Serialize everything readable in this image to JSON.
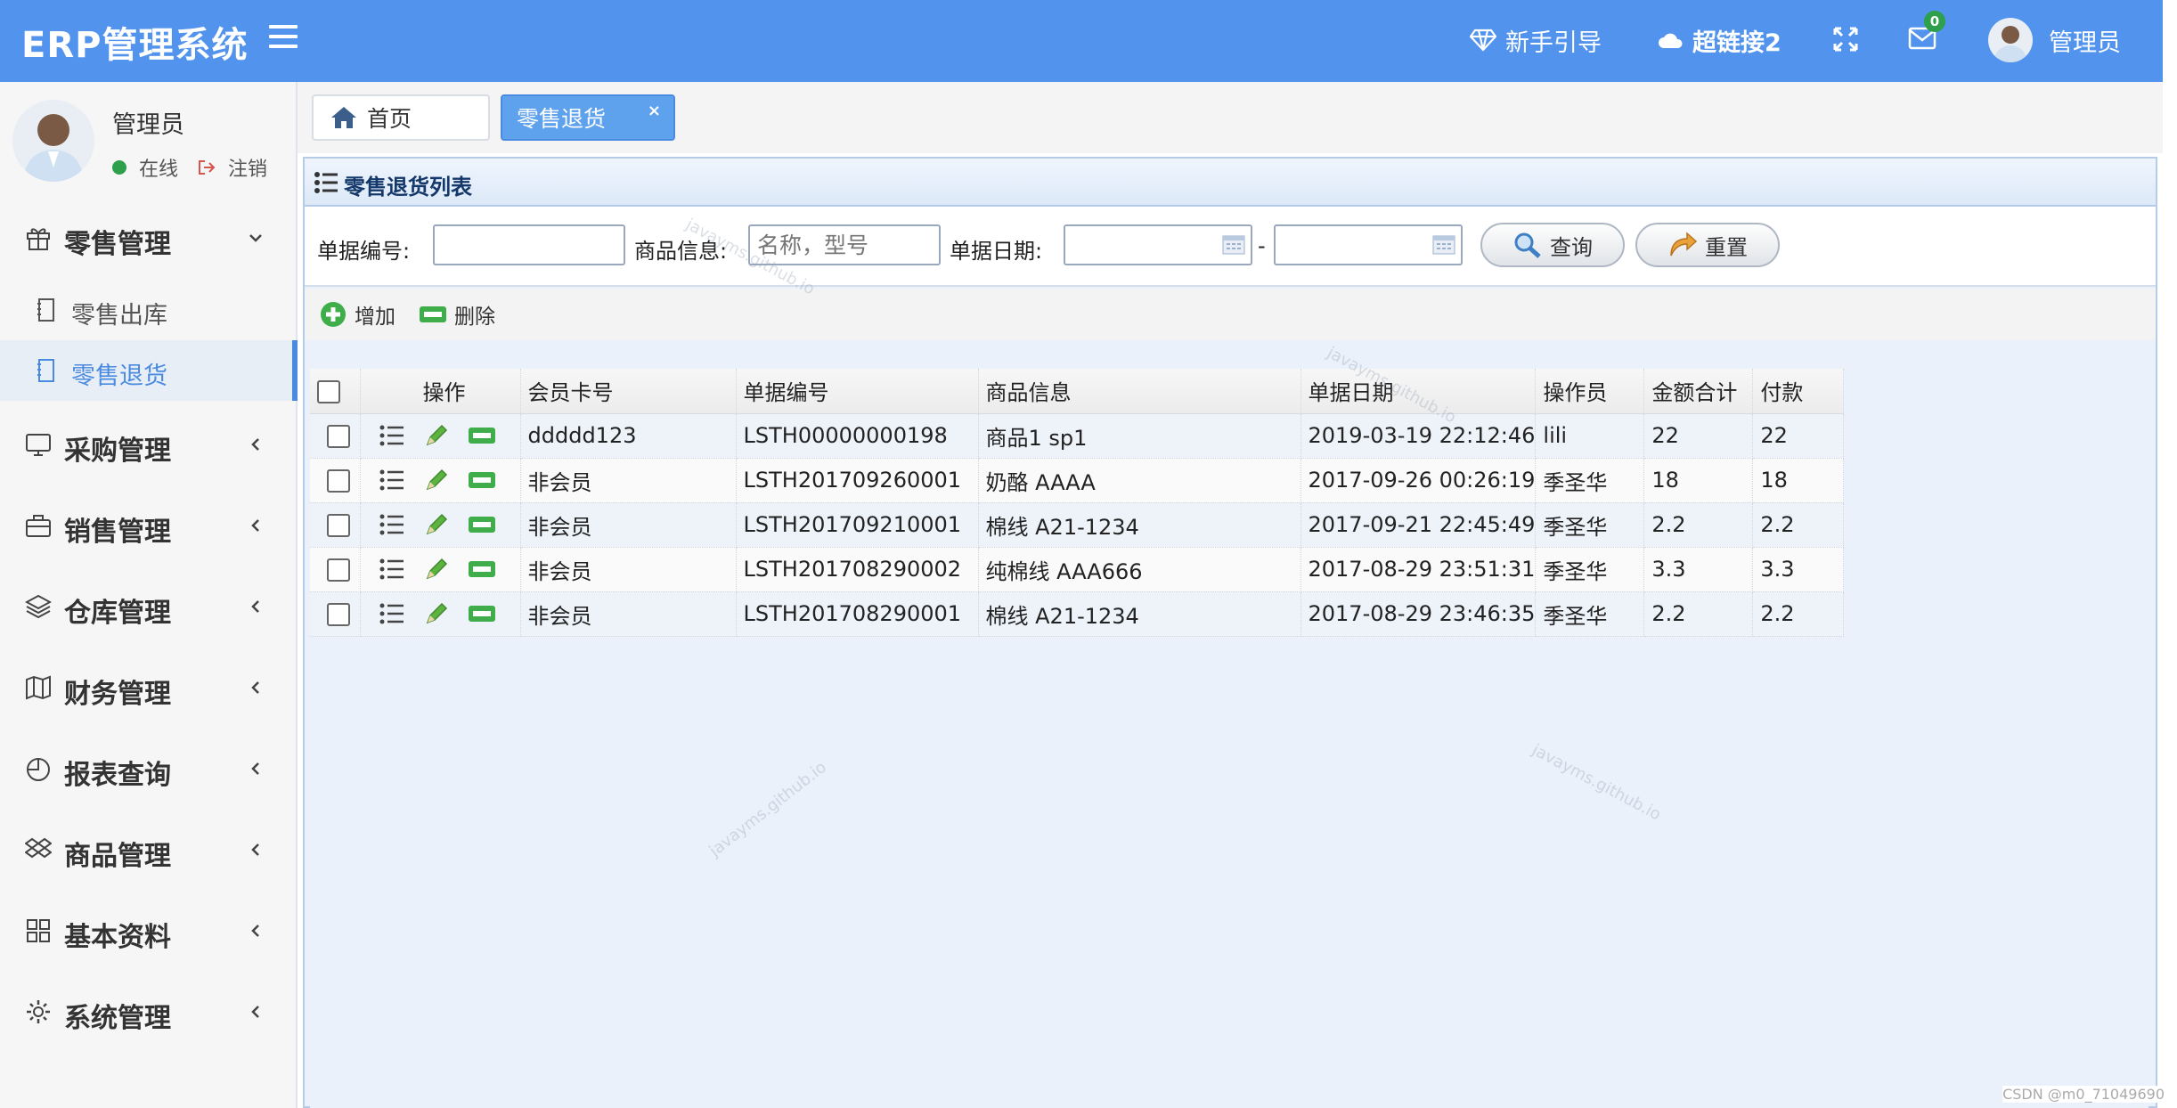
{
  "header": {
    "logo": "ERP管理系统",
    "guide": "新手引导",
    "link": "超链接2",
    "mail_count": "0",
    "user": "管理员"
  },
  "sidebar": {
    "user_name": "管理员",
    "status": "在线",
    "logout": "注销",
    "menus": [
      {
        "label": "零售管理",
        "icon": "gift-icon",
        "expanded": true,
        "children": [
          {
            "label": "零售出库"
          },
          {
            "label": "零售退货",
            "active": true
          }
        ]
      },
      {
        "label": "采购管理",
        "icon": "monitor-icon"
      },
      {
        "label": "销售管理",
        "icon": "briefcase-icon"
      },
      {
        "label": "仓库管理",
        "icon": "layers-icon"
      },
      {
        "label": "财务管理",
        "icon": "map-icon"
      },
      {
        "label": "报表查询",
        "icon": "pie-chart-icon"
      },
      {
        "label": "商品管理",
        "icon": "dropbox-icon"
      },
      {
        "label": "基本资料",
        "icon": "grid-icon"
      },
      {
        "label": "系统管理",
        "icon": "gear-icon"
      }
    ]
  },
  "tabs": {
    "home": "首页",
    "active": "零售退货",
    "close": "×"
  },
  "panel": {
    "title": "零售退货列表"
  },
  "search": {
    "number_label": "单据编号:",
    "number_value": "",
    "goods_label": "商品信息:",
    "goods_placeholder": "名称，型号",
    "date_label": "单据日期:",
    "date_sep": "-",
    "query": "查询",
    "reset": "重置"
  },
  "toolbar": {
    "add": "增加",
    "delete": "删除"
  },
  "table": {
    "headers": [
      "操作",
      "会员卡号",
      "单据编号",
      "商品信息",
      "单据日期",
      "操作员",
      "金额合计",
      "付款"
    ],
    "rows": [
      [
        "ddddd123",
        "LSTH00000000198",
        "商品1 sp1",
        "2019-03-19 22:12:46",
        "lili",
        "22",
        "22"
      ],
      [
        "非会员",
        "LSTH201709260001",
        "奶酪 AAAA",
        "2017-09-26 00:26:19",
        "季圣华",
        "18",
        "18"
      ],
      [
        "非会员",
        "LSTH201709210001",
        "棉线 A21-1234",
        "2017-09-21 22:45:49",
        "季圣华",
        "2.2",
        "2.2"
      ],
      [
        "非会员",
        "LSTH201708290002",
        "纯棉线 AAA666",
        "2017-08-29 23:51:31",
        "季圣华",
        "3.3",
        "3.3"
      ],
      [
        "非会员",
        "LSTH201708290001",
        "棉线 A21-1234",
        "2017-08-29 23:46:35",
        "季圣华",
        "2.2",
        "2.2"
      ]
    ]
  },
  "watermark": "javayms.github.io",
  "credit": "CSDN @m0_71049690",
  "colors": {
    "header_bg": "#5193ed",
    "accent": "#4a8be0",
    "online": "#2e9f4a"
  }
}
